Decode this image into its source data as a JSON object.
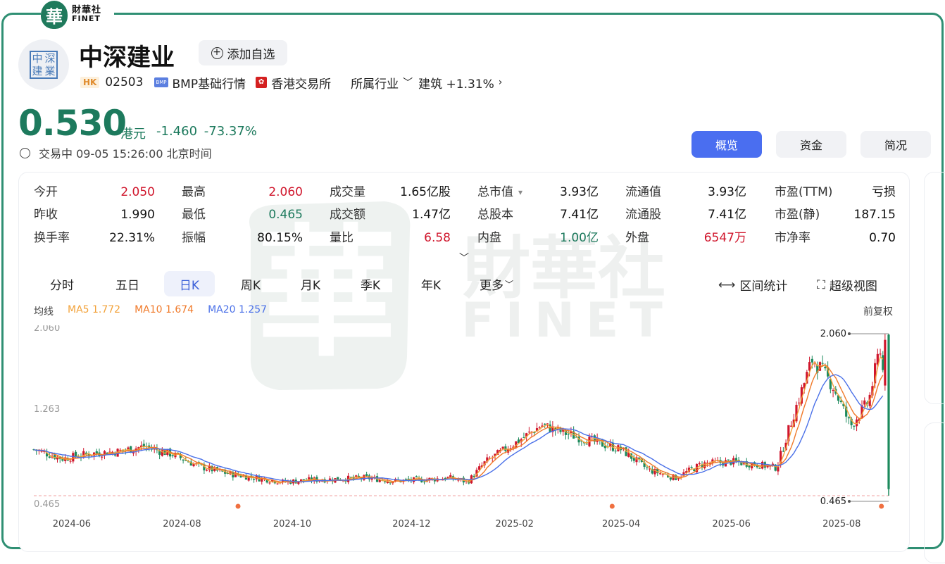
{
  "brand": {
    "seal": "華",
    "name_cn": "財華社",
    "name_en": "FINET"
  },
  "header": {
    "logo_chars": [
      "中",
      "深",
      "建",
      "業"
    ],
    "company_name": "中深建业",
    "add_watch_label": "添加自选",
    "market_badge": "HK",
    "code": "02503",
    "bmp_badge": "BMP",
    "bmp_label": "BMP基础行情",
    "exchange": "香港交易所",
    "industry_label": "所属行业",
    "industry_name": "建筑 +1.31%"
  },
  "quote": {
    "price": "0.530",
    "currency": "港元",
    "change": "-1.460 -73.37%",
    "status": "交易中 09-05 15:26:00 北京时间"
  },
  "tabs": [
    {
      "label": "概览",
      "active": true
    },
    {
      "label": "资金",
      "active": false
    },
    {
      "label": "简况",
      "active": false
    }
  ],
  "stats": [
    [
      {
        "label": "今开",
        "value": "2.050",
        "color": "red"
      },
      {
        "label": "最高",
        "value": "2.060",
        "color": "red"
      },
      {
        "label": "成交量",
        "value": "1.65亿股",
        "color": ""
      },
      {
        "label": "总市值",
        "value": "3.93亿",
        "color": "",
        "dropdown": true
      },
      {
        "label": "流通值",
        "value": "3.93亿",
        "color": ""
      },
      {
        "label": "市盈(TTM)",
        "value": "亏损",
        "color": ""
      }
    ],
    [
      {
        "label": "昨收",
        "value": "1.990",
        "color": ""
      },
      {
        "label": "最低",
        "value": "0.465",
        "color": "green"
      },
      {
        "label": "成交额",
        "value": "1.47亿",
        "color": ""
      },
      {
        "label": "总股本",
        "value": "7.41亿",
        "color": ""
      },
      {
        "label": "流通股",
        "value": "7.41亿",
        "color": ""
      },
      {
        "label": "市盈(静)",
        "value": "187.15",
        "color": ""
      }
    ],
    [
      {
        "label": "换手率",
        "value": "22.31%",
        "color": ""
      },
      {
        "label": "振幅",
        "value": "80.15%",
        "color": ""
      },
      {
        "label": "量比",
        "value": "6.58",
        "color": "red"
      },
      {
        "label": "内盘",
        "value": "1.00亿",
        "color": "green"
      },
      {
        "label": "外盘",
        "value": "6547万",
        "color": "red"
      },
      {
        "label": "市净率",
        "value": "0.70",
        "color": ""
      }
    ]
  ],
  "periods": [
    {
      "label": "分时",
      "active": false
    },
    {
      "label": "五日",
      "active": false
    },
    {
      "label": "日K",
      "active": true
    },
    {
      "label": "周K",
      "active": false
    },
    {
      "label": "月K",
      "active": false
    },
    {
      "label": "季K",
      "active": false
    },
    {
      "label": "年K",
      "active": false
    },
    {
      "label": "更多",
      "active": false
    }
  ],
  "tools": {
    "range_stats": "区间统计",
    "super_view": "超级视图"
  },
  "ma": {
    "title": "均线",
    "items": [
      {
        "label": "MA5 1.772",
        "color": "#f2a23a"
      },
      {
        "label": "MA10 1.674",
        "color": "#f07a2a"
      },
      {
        "label": "MA20 1.257",
        "color": "#4a70e8"
      }
    ],
    "adjust": "前复权"
  },
  "chart_data": {
    "type": "candlestick",
    "y_ticks": [
      "2.060",
      "1.263",
      "0.465"
    ],
    "ylim": [
      0.465,
      2.06
    ],
    "x_ticks": [
      "2024-06",
      "2024-08",
      "2024-10",
      "2024-12",
      "2025-02",
      "2025-04",
      "2025-06",
      "2025-08"
    ],
    "high_marker": "2.060",
    "low_marker": "0.465",
    "up_color": "#d0162c",
    "down_color": "#1d8a5d",
    "ma_colors": {
      "MA5": "#f2a23a",
      "MA10": "#f07a2a",
      "MA20": "#4a70e8"
    },
    "close_trend": [
      [
        "2024-05-20",
        0.92
      ],
      [
        "2024-06-05",
        0.83
      ],
      [
        "2024-06-20",
        0.88
      ],
      [
        "2024-07-05",
        0.9
      ],
      [
        "2024-07-20",
        0.95
      ],
      [
        "2024-08-05",
        0.87
      ],
      [
        "2024-08-20",
        0.75
      ],
      [
        "2024-09-05",
        0.68
      ],
      [
        "2024-09-20",
        0.64
      ],
      [
        "2024-10-05",
        0.6
      ],
      [
        "2024-10-20",
        0.62
      ],
      [
        "2024-11-05",
        0.63
      ],
      [
        "2024-11-20",
        0.64
      ],
      [
        "2024-12-05",
        0.61
      ],
      [
        "2024-12-20",
        0.62
      ],
      [
        "2025-01-05",
        0.64
      ],
      [
        "2025-01-15",
        0.6
      ],
      [
        "2025-01-25",
        0.8
      ],
      [
        "2025-02-10",
        0.98
      ],
      [
        "2025-02-25",
        1.16
      ],
      [
        "2025-03-10",
        1.08
      ],
      [
        "2025-03-25",
        1.0
      ],
      [
        "2025-04-10",
        0.92
      ],
      [
        "2025-04-25",
        0.72
      ],
      [
        "2025-05-10",
        0.64
      ],
      [
        "2025-05-25",
        0.78
      ],
      [
        "2025-06-10",
        0.8
      ],
      [
        "2025-06-25",
        0.77
      ],
      [
        "2025-07-05",
        0.74
      ],
      [
        "2025-07-15",
        1.3
      ],
      [
        "2025-07-25",
        1.82
      ],
      [
        "2025-08-05",
        1.55
      ],
      [
        "2025-08-15",
        1.15
      ],
      [
        "2025-08-25",
        1.4
      ],
      [
        "2025-09-01",
        1.99
      ],
      [
        "2025-09-05",
        0.53
      ]
    ],
    "event_markers": [
      "2024-09-10",
      "2025-04-05",
      "2025-09-01"
    ]
  }
}
